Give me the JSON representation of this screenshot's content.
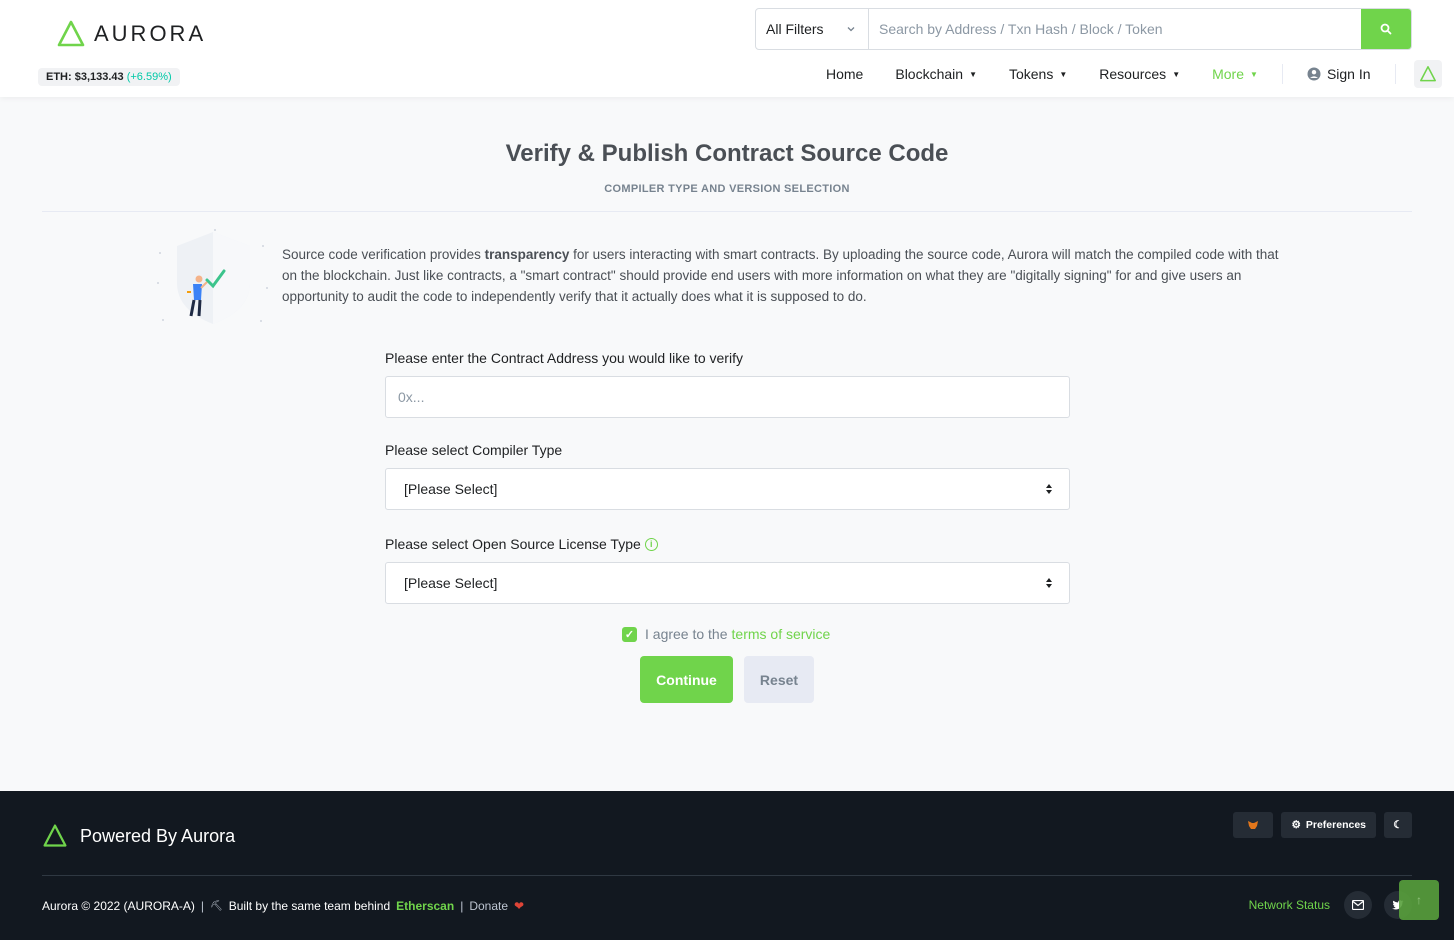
{
  "header": {
    "logo_text": "AURORA",
    "eth_label": "ETH: $3,133.43",
    "eth_change": "(+6.59%)",
    "search": {
      "filter_label": "All Filters",
      "placeholder": "Search by Address / Txn Hash / Block / Token"
    },
    "nav": {
      "home": "Home",
      "blockchain": "Blockchain",
      "tokens": "Tokens",
      "resources": "Resources",
      "more": "More",
      "sign_in": "Sign In"
    }
  },
  "main": {
    "title": "Verify & Publish Contract Source Code",
    "subtitle": "COMPILER TYPE AND VERSION SELECTION",
    "intro_before": "Source code verification provides ",
    "intro_bold": "transparency",
    "intro_after": " for users interacting with smart contracts. By uploading the source code, Aurora will match the compiled code with that on the blockchain. Just like contracts, a \"smart contract\" should provide end users with more information on what they are \"digitally signing\" for and give users an opportunity to audit the code to independently verify that it actually does what it is supposed to do.",
    "form": {
      "address_label": "Please enter the Contract Address you would like to verify",
      "address_placeholder": "0x...",
      "compiler_label": "Please select Compiler Type",
      "compiler_value": "[Please Select]",
      "license_label": "Please select Open Source License Type",
      "license_value": "[Please Select]",
      "agree_text": "I agree to the",
      "terms_link": "terms of service",
      "continue": "Continue",
      "reset": "Reset"
    }
  },
  "footer": {
    "brand": "Powered By Aurora",
    "preferences": "Preferences",
    "copyright": "Aurora © 2022 (AURORA-A)",
    "sep": "|",
    "built_by": "Built by the same team behind",
    "etherscan": "Etherscan",
    "donate": "Donate",
    "network_status": "Network Status"
  },
  "colors": {
    "accent": "#70d44b",
    "footer_bg": "#121820",
    "positive": "#00c9a7"
  }
}
